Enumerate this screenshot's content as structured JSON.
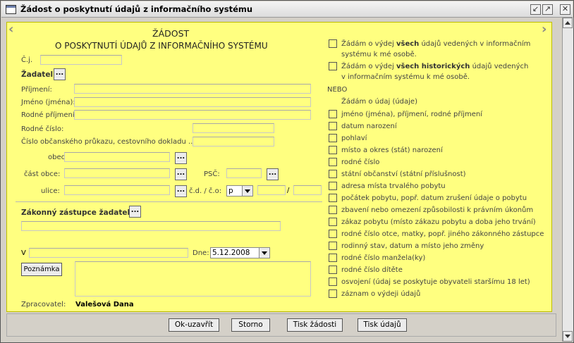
{
  "window": {
    "title": "Žádost o poskytnutí údajů z informačního systému",
    "icons": [
      "restore-icon",
      "maximize-icon",
      "close-icon"
    ]
  },
  "form": {
    "heading1": "ŽÁDOST",
    "heading2": "O POSKYTNUTÍ ÚDAJŮ Z INFORMAČNÍHO SYSTÉMU",
    "cj_label": "Č.j.",
    "zadatel_label": "Žadatel",
    "dots": "...",
    "prijmeni_label": "Příjmení:",
    "jmeno_label": "Jméno (jména):",
    "rodne_prijmeni_label": "Rodné příjmení:",
    "rodne_cislo_label": "Rodné číslo:",
    "cislo_op_label": "Číslo občanského průkazu, cestovního dokladu ...:",
    "obec_label": "obec:",
    "cast_obce_label": "část obce:",
    "psc_label": "PSČ:",
    "ulice_label": "ulice:",
    "cd_co_label": "č.d. / č.o:",
    "cd_type_value": "p",
    "slash": "/",
    "zastupce_label": "Zákonný zástupce žadatele",
    "v_label": "V",
    "dne_label": "Dne:",
    "date_value": "5.12.2008",
    "poznamka_button": "Poznámka",
    "zpracovatel_label": "Zpracovatel:",
    "zpracovatel_value": "Valešová Dana"
  },
  "right": {
    "req_all_pre": "Žádám o výdej ",
    "req_all_bold": "všech",
    "req_all_post": " údajů vedených v informačním",
    "req_all_line2": "systému k mé osobě.",
    "req_hist_pre": "Žádám o výdej ",
    "req_hist_bold": "všech historických",
    "req_hist_post": " údajů vedených",
    "req_hist_line2": "v informačním systému k mé osobě.",
    "nebo": "NEBO",
    "zadam_udaj": "Žádám o údaj (údaje)",
    "items": [
      "jméno (jména), příjmení, rodné příjmení",
      "datum narození",
      "pohlaví",
      "místo a okres (stát) narození",
      "rodné číslo",
      "státní občanství (státní příslušnost)",
      "adresa místa trvalého pobytu",
      "počátek pobytu, popř. datum zrušení údaje o pobytu",
      "zbavení nebo omezení způsobilosti k právním úkonům",
      "zákaz pobytu (místo zákazu pobytu a doba jeho trvání)",
      "rodné číslo otce, matky, popř. jiného zákonného zástupce",
      "rodinný stav, datum a místo jeho změny",
      "rodné číslo manžela(ky)",
      "rodné číslo dítěte",
      "osvojení (údaj se poskytuje obyvateli staršímu 18 let)",
      "záznam o výdeji údajů"
    ]
  },
  "buttons": {
    "ok": "Ok-uzavřít",
    "storno": "Storno",
    "tisk_zadosti": "Tisk žádosti",
    "tisk_udaju": "Tisk údajů"
  },
  "colors": {
    "form_background": "#ffff80",
    "window_background": "#d4d0c8"
  }
}
